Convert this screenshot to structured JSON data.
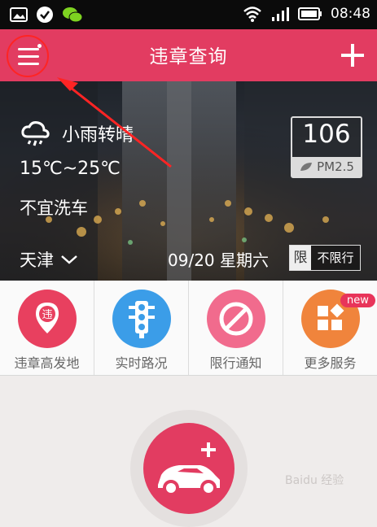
{
  "status_bar": {
    "time": "08:48",
    "icons": [
      "image-icon",
      "check-icon",
      "wechat-icon",
      "wifi-icon",
      "signal-icon",
      "battery-icon"
    ]
  },
  "app_bar": {
    "title": "违章查询",
    "menu_icon": "menu-icon",
    "add_icon": "plus-icon"
  },
  "hero": {
    "weather": "小雨转晴",
    "temperature": "15℃~25℃",
    "car_wash": "不宜洗车",
    "city": "天津",
    "date": "09/20 星期六",
    "limit_tag": "限",
    "limit_value": "不限行",
    "aqi_value": "106",
    "aqi_label": "PM2.5"
  },
  "services": [
    {
      "label": "违章高发地",
      "color": "#e8405f",
      "icon": "pin-violation-icon",
      "icon_char": "违"
    },
    {
      "label": "实时路况",
      "color": "#3b9de8",
      "icon": "traffic-light-icon"
    },
    {
      "label": "限行通知",
      "color": "#f16b8d",
      "icon": "no-entry-icon"
    },
    {
      "label": "更多服务",
      "color": "#f0843c",
      "icon": "grid-more-icon",
      "badge": "new"
    }
  ],
  "bottom": {
    "add_car_icon": "add-car-icon",
    "watermark": "Baidu 经验"
  },
  "colors": {
    "accent": "#e23c61",
    "annotation": "#ff2424"
  }
}
